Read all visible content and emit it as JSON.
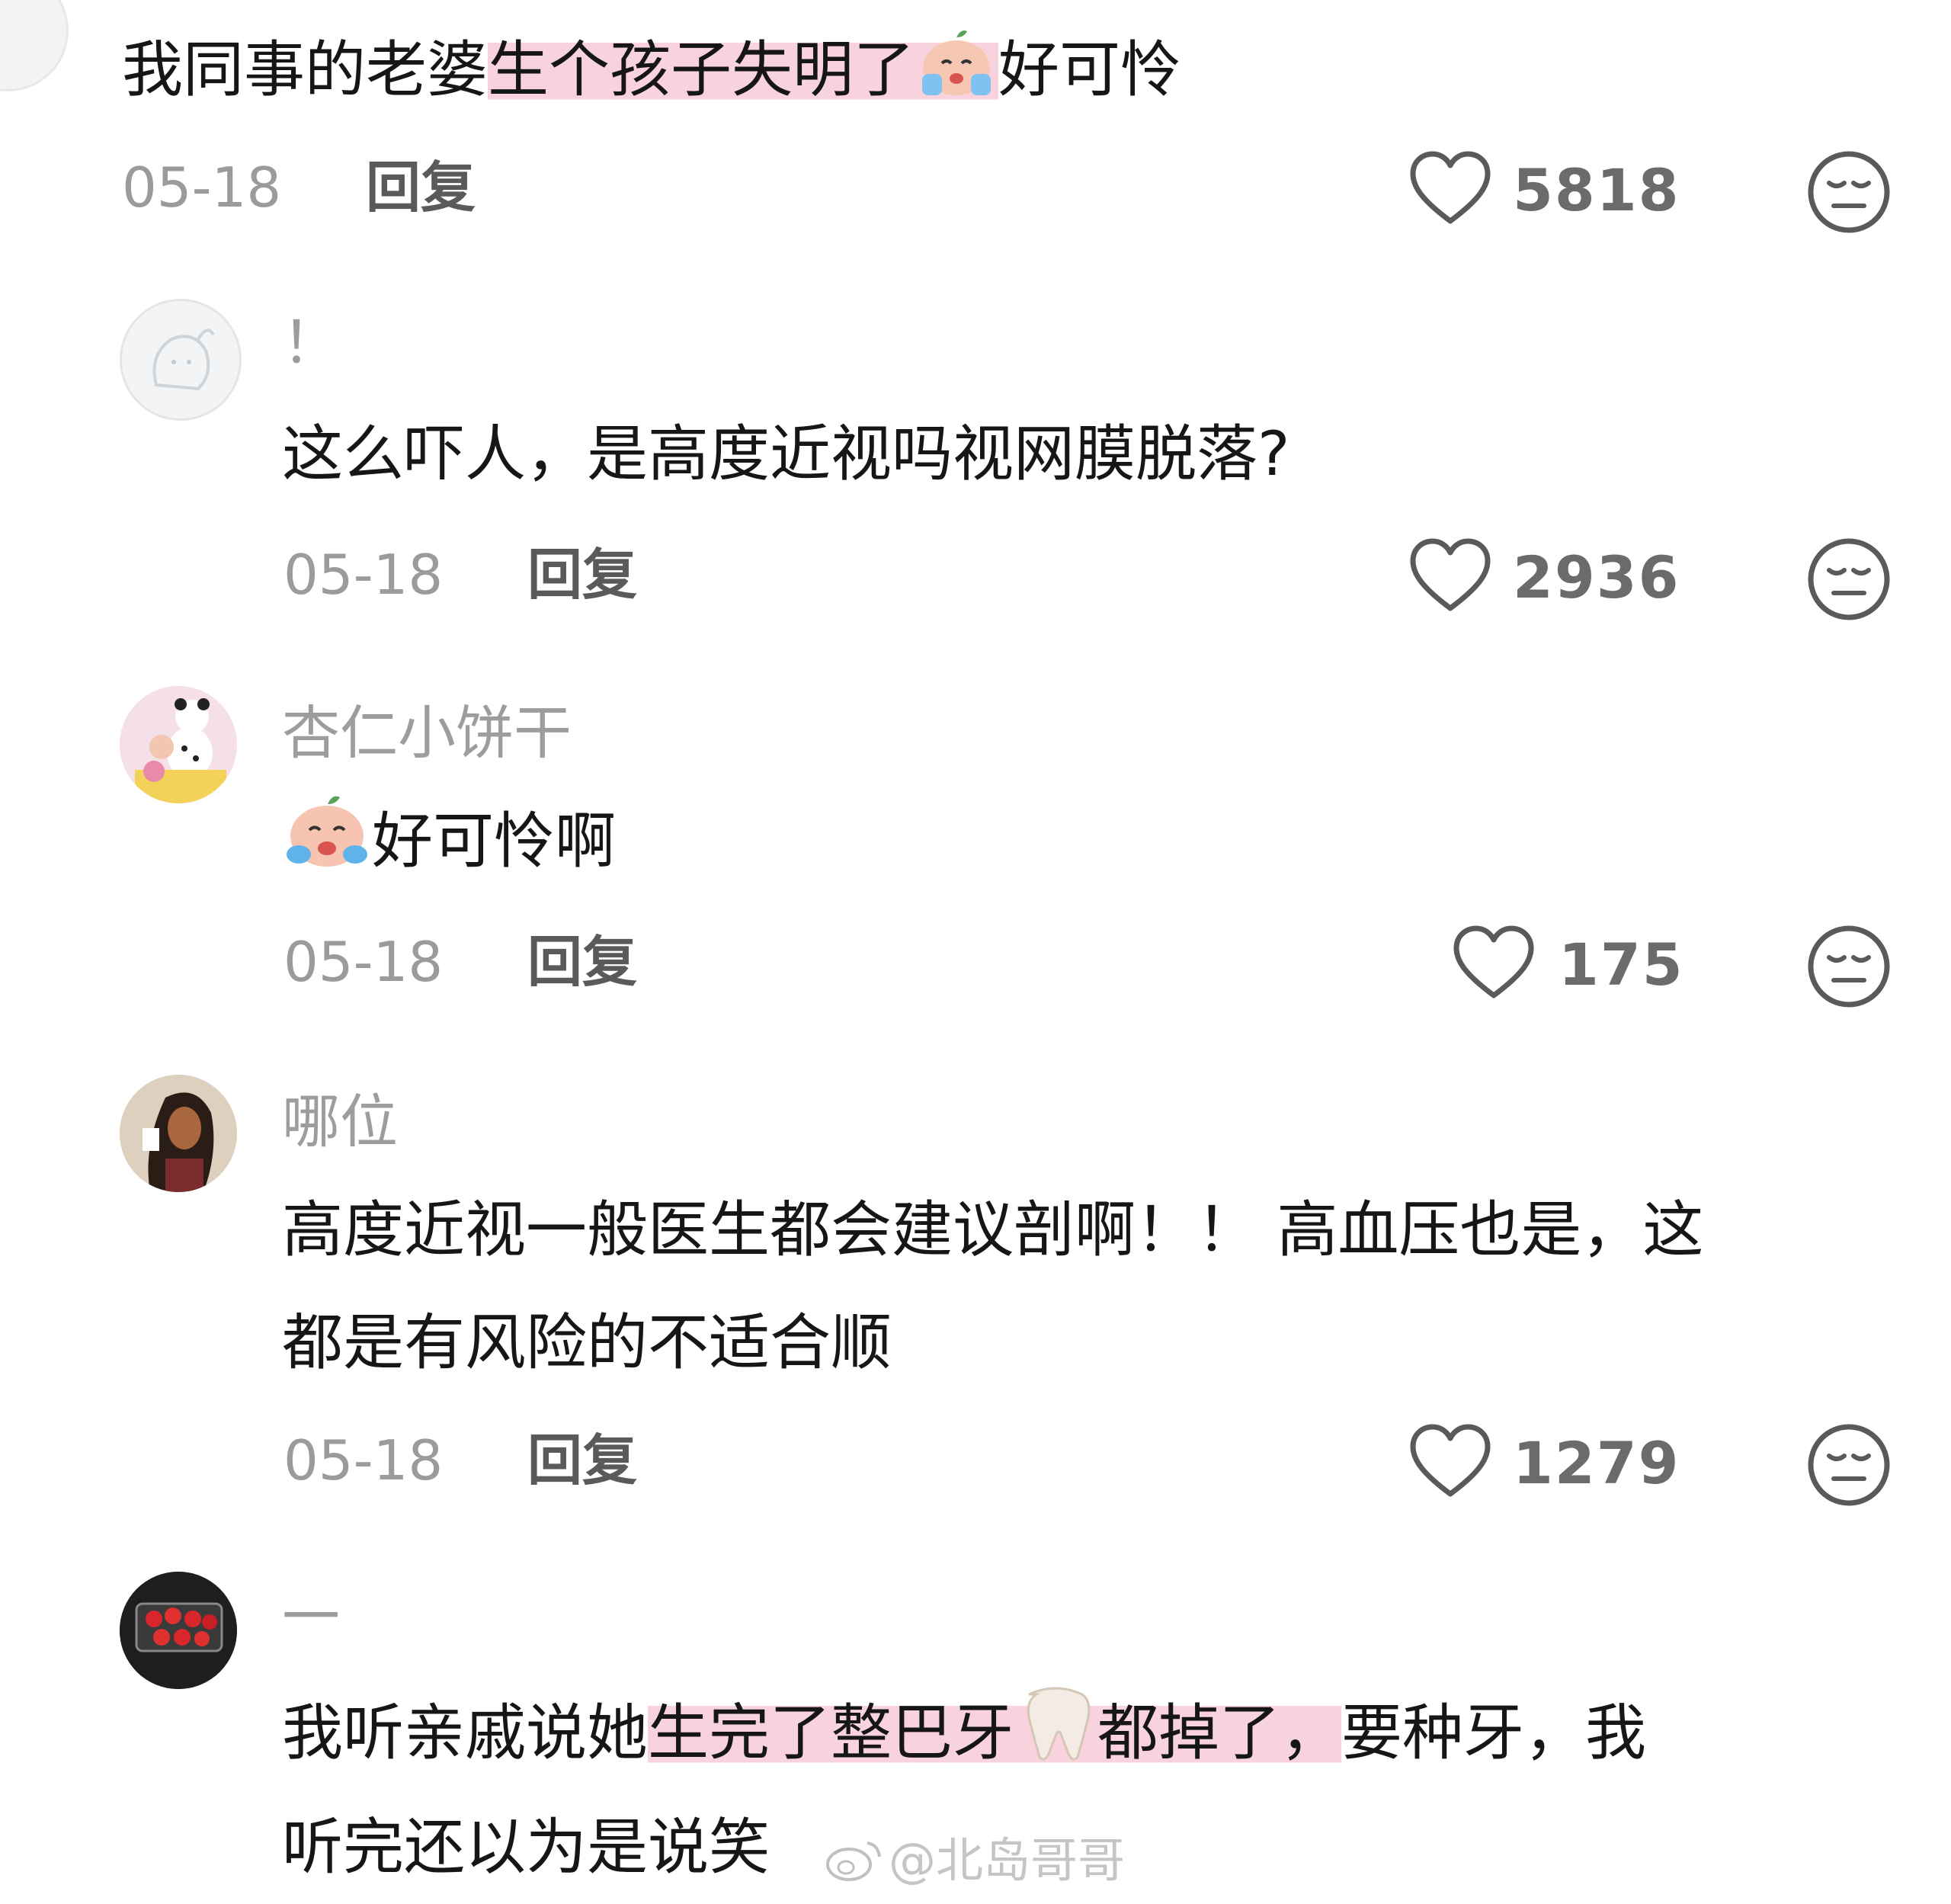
{
  "comments": [
    {
      "text_plain": "我同事的老婆",
      "text_highlight": "生个孩子失明了",
      "text_after": "好可怜",
      "emoji": "crying-face-emoji",
      "date": "05-18",
      "reply_label": "回复",
      "likes": "5818"
    },
    {
      "username": "！",
      "text": "这么吓人，是高度近视吗视网膜脱落?",
      "date": "05-18",
      "reply_label": "回复",
      "likes": "2936"
    },
    {
      "username": "杏仁小饼干",
      "emoji": "crying-face-emoji",
      "text": "好可怜啊",
      "date": "05-18",
      "reply_label": "回复",
      "likes": "175"
    },
    {
      "username": "哪位",
      "text_line1": "高度近视一般医生都会建议剖啊！！ 高血压也是，这",
      "text_line2": "都是有风险的不适合顺",
      "date": "05-18",
      "reply_label": "回复",
      "likes": "1279"
    },
    {
      "username": "一",
      "text_line1_plain": "我听亲戚说她",
      "text_line1_highlight_a": "生完了整巴牙",
      "text_line1_highlight_b": "都掉了，",
      "text_line1_after": "要种牙，我",
      "emoji": "tooth-emoji",
      "text_line2": "听完还以为是说笑"
    }
  ],
  "watermark": "@北岛哥哥",
  "colors": {
    "highlight": "#f8d3dd",
    "meta_gray": "#9b9b9b",
    "text": "#161616"
  }
}
